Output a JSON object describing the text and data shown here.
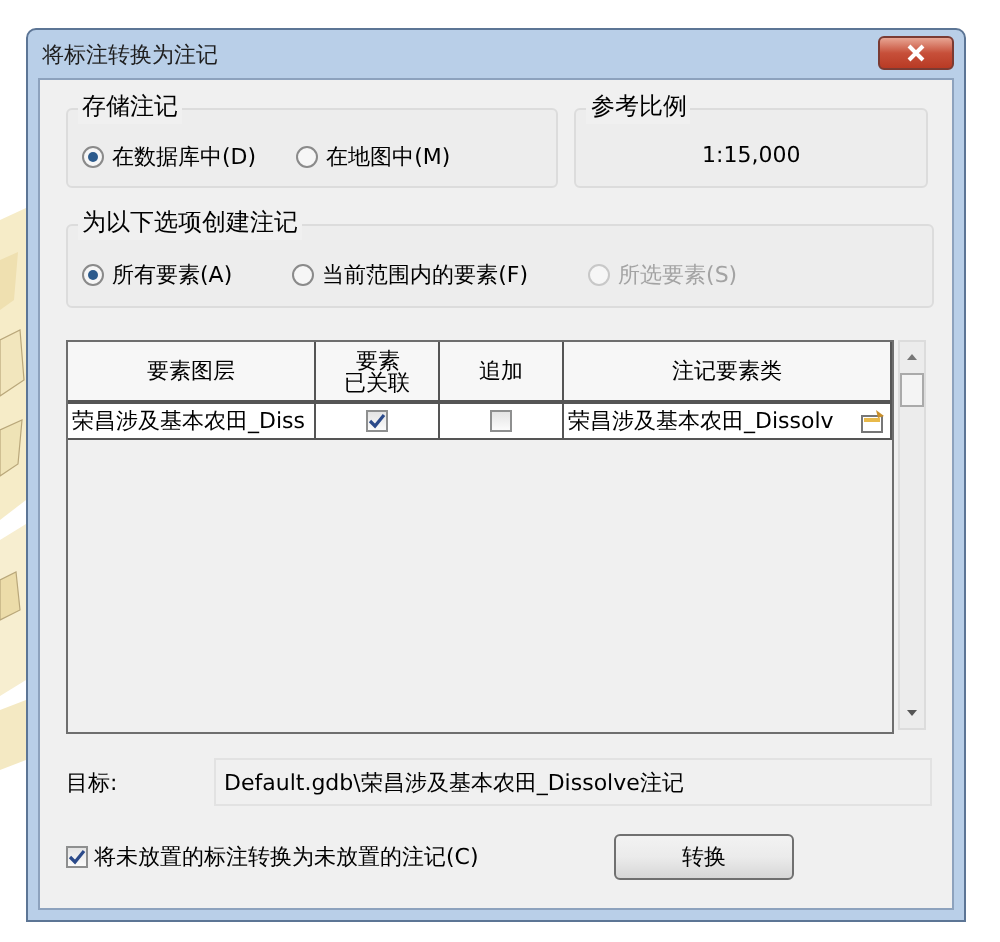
{
  "window": {
    "title": "将标注转换为注记"
  },
  "store": {
    "legend": "存储注记",
    "options": [
      {
        "label": "在数据库中(D)",
        "selected": true
      },
      {
        "label": "在地图中(M)",
        "selected": false
      }
    ]
  },
  "reference_scale": {
    "legend": "参考比例",
    "value": "1:15,000"
  },
  "create_for": {
    "legend": "为以下选项创建注记",
    "options": [
      {
        "label": "所有要素(A)",
        "selected": true,
        "disabled": false
      },
      {
        "label": "当前范围内的要素(F)",
        "selected": false,
        "disabled": false
      },
      {
        "label": "所选要素(S)",
        "selected": false,
        "disabled": true
      }
    ]
  },
  "table": {
    "columns": [
      "要素图层",
      "要素已关联",
      "追加",
      "注记要素类"
    ],
    "rows": [
      {
        "feature_layer": "荣昌涉及基本农田_Diss",
        "features_linked": true,
        "append": false,
        "annotation_class": "荣昌涉及基本农田_Dissolv"
      }
    ]
  },
  "target": {
    "label": "目标:",
    "value": "Default.gdb\\荣昌涉及基本农田_Dissolve注记"
  },
  "convert_unplaced": {
    "label": "将未放置的标注转换为未放置的注记(C)",
    "checked": true
  },
  "buttons": [
    "转换"
  ]
}
